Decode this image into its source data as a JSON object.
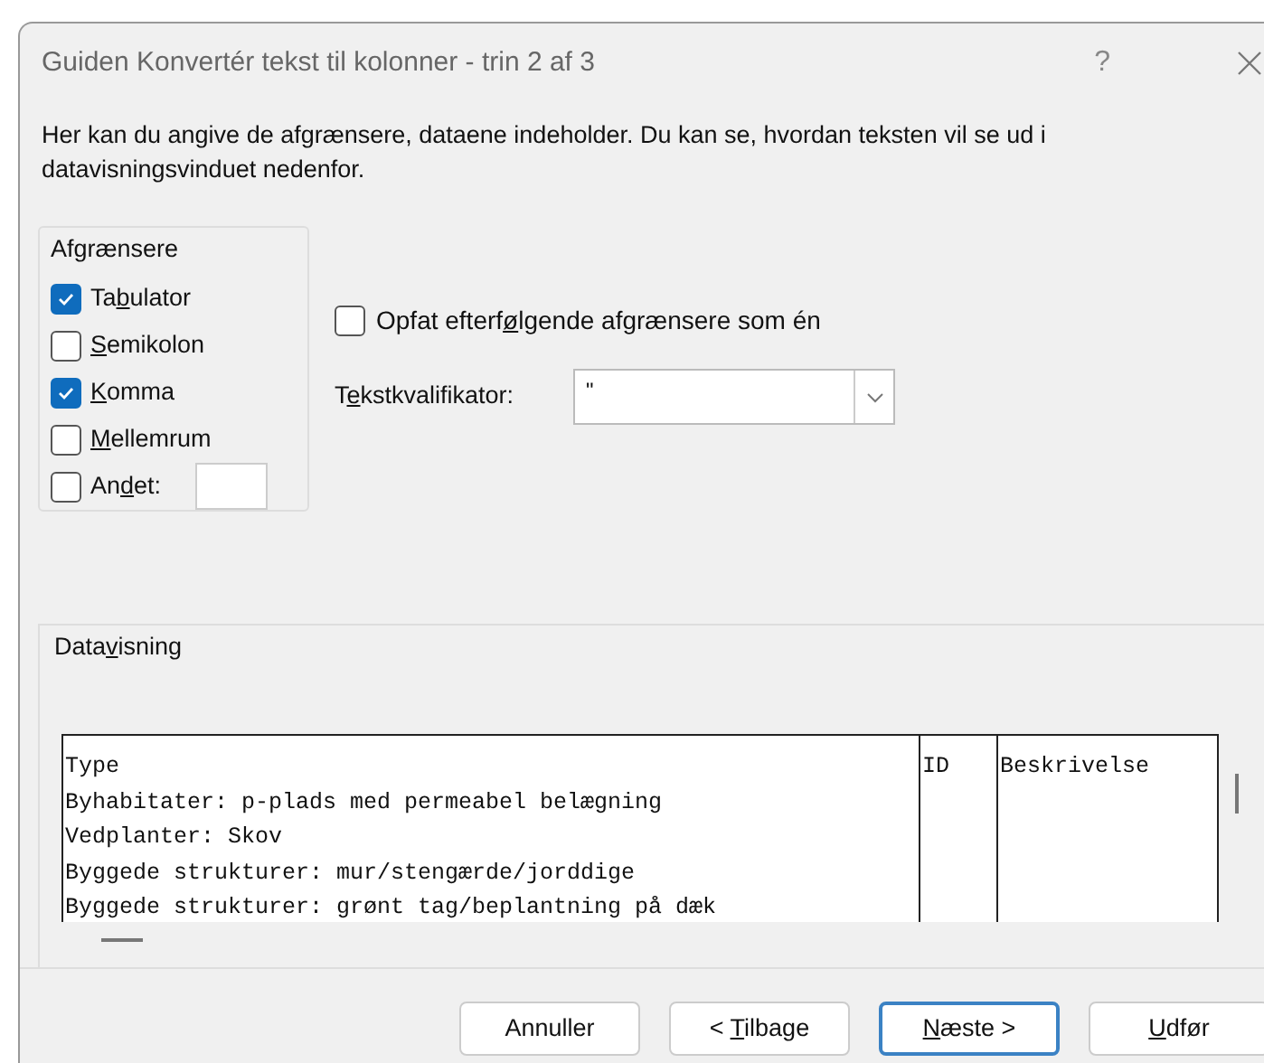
{
  "window": {
    "title": "Guiden Konvertér tekst til kolonner - trin 2 af 3",
    "help": "?"
  },
  "description": "Her kan du angive de afgrænsere, dataene indeholder. Du kan se, hvordan teksten vil se ud i datavisningsvinduet nedenfor.",
  "delimiters": {
    "title": "Afgrænsere",
    "items": [
      {
        "pre": "Ta",
        "key": "b",
        "post": "ulator",
        "checked": true
      },
      {
        "key": "S",
        "post": "emikolon",
        "checked": false
      },
      {
        "key": "K",
        "post": "omma",
        "checked": true
      },
      {
        "key": "M",
        "post": "ellemrum",
        "checked": false
      },
      {
        "pre": "An",
        "key": "d",
        "post": "et:",
        "checked": false,
        "kind": "other"
      }
    ]
  },
  "consecutive": {
    "pre": "Opfat efterf",
    "key": "ø",
    "post": "lgende afgrænsere som én",
    "checked": false
  },
  "qualifier": {
    "pre": "T",
    "key": "e",
    "post": "kstkvalifikator:",
    "value": "\""
  },
  "preview": {
    "pre": "Data",
    "key": "v",
    "post": "isning",
    "columns": [
      {
        "lines": [
          "Type",
          "Byhabitater: p-plads med permeabel belægning",
          "Vedplanter: Skov",
          "Byggede strukturer: mur/stengærde/jorddige",
          "Byggede strukturer: grønt tag/beplantning på dæk"
        ]
      },
      {
        "lines": [
          "ID"
        ]
      },
      {
        "lines": [
          "Beskrivelse"
        ]
      }
    ]
  },
  "buttons": [
    {
      "pre": "Annuller",
      "focused": false
    },
    {
      "pre": "< ",
      "key": "T",
      "post": "ilbage",
      "focused": false
    },
    {
      "key": "N",
      "post": "æste >",
      "focused": true
    },
    {
      "key": "U",
      "post": "dfør",
      "focused": false
    }
  ]
}
